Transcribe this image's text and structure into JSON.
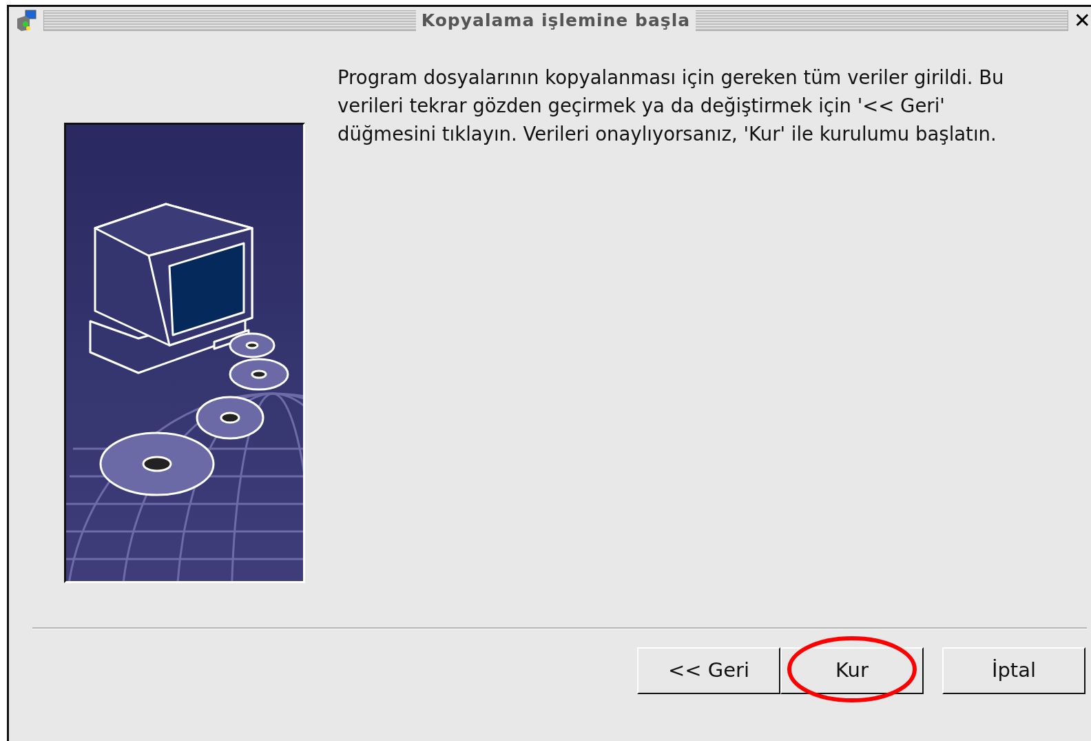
{
  "window": {
    "title": "Kopyalama işlemine başla",
    "close": "✕"
  },
  "message": "Program dosyalarının kopyalanması için gereken tüm veriler girildi. Bu verileri tekrar gözden geçirmek ya da değiştirmek için '<< Geri' düğmesini tıklayın. Verileri onaylıyorsanız, 'Kur' ile kurulumu başlatın.",
  "buttons": [
    {
      "label": "<< Geri",
      "highlighted": false
    },
    {
      "label": "Kur",
      "highlighted": true
    },
    {
      "label": "İptal",
      "highlighted": false
    }
  ]
}
